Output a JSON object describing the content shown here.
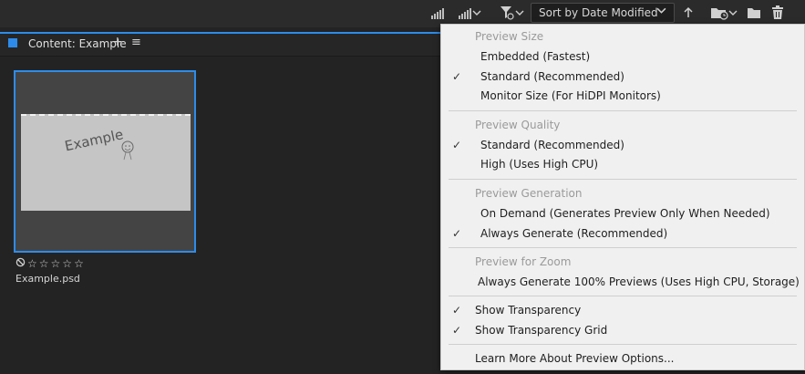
{
  "toolbar": {
    "sort_label": "Sort by Date Modified"
  },
  "panel": {
    "title": "Content: Example",
    "plus": "+",
    "menu": "≡"
  },
  "file": {
    "name": "Example.psd",
    "rating": 0,
    "stars": [
      "☆",
      "☆",
      "☆",
      "☆",
      "☆"
    ],
    "thumbnail_text": "Example"
  },
  "menu": {
    "preview_size_title": "Preview Size",
    "embedded": "Embedded (Fastest)",
    "standard_size": "Standard (Recommended)",
    "monitor_size": "Monitor Size (For HiDPI Monitors)",
    "preview_quality_title": "Preview Quality",
    "standard_quality": "Standard (Recommended)",
    "high_quality": "High (Uses High CPU)",
    "preview_generation_title": "Preview Generation",
    "on_demand": "On Demand (Generates Preview Only When Needed)",
    "always_generate": "Always Generate (Recommended)",
    "preview_zoom_title": "Preview for Zoom",
    "always_100": "Always Generate 100% Previews (Uses High CPU, Storage)",
    "show_transparency": "Show Transparency",
    "show_transparency_grid": "Show Transparency Grid",
    "learn_more": "Learn More About Preview Options..."
  },
  "colors": {
    "accent": "#2d8ceb",
    "menu_bg": "#f0f0f0",
    "app_bg": "#232323"
  }
}
